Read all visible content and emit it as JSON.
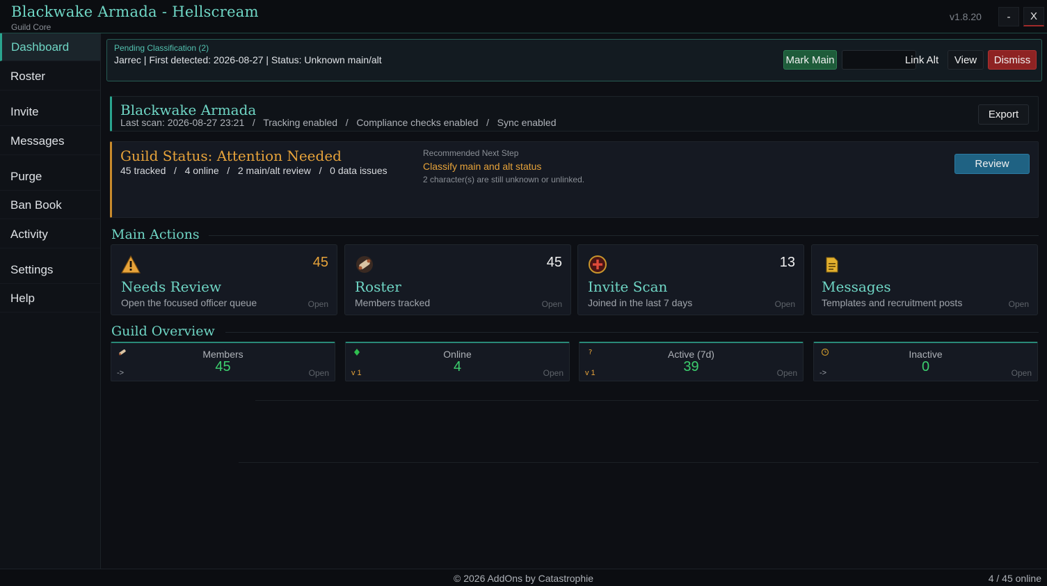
{
  "window": {
    "title": "Blackwake Armada - Hellscream",
    "subtitle": "Guild Core",
    "version": "v1.8.20",
    "minimize_label": "-",
    "close_label": "X"
  },
  "sidebar": {
    "items": [
      {
        "label": "Dashboard",
        "active": true
      },
      {
        "label": "Roster"
      },
      {
        "label": "Invite"
      },
      {
        "label": "Messages"
      },
      {
        "label": "Purge"
      },
      {
        "label": "Ban Book"
      },
      {
        "label": "Activity"
      },
      {
        "label": "Settings"
      },
      {
        "label": "Help"
      }
    ]
  },
  "pending": {
    "title": "Pending Classification (2)",
    "detail": "Jarrec | First detected: 2026-08-27 | Status: Unknown main/alt",
    "mark_main": "Mark Main",
    "link_alt": "Link Alt",
    "view": "View",
    "dismiss": "Dismiss"
  },
  "guild": {
    "name": "Blackwake Armada",
    "meta": "Last scan: 2026-08-27 23:21   /   Tracking enabled   /   Compliance checks enabled   /   Sync enabled",
    "export_label": "Export"
  },
  "status": {
    "title": "Guild Status: Attention Needed",
    "stats": "45 tracked   /   4 online   /   2 main/alt review   /   0 data issues",
    "next_label": "Recommended Next Step",
    "next_step": "Classify main and alt status",
    "next_note": "2 character(s) are still unknown or unlinked.",
    "review_label": "Review",
    "accent_color": "#e7a33a"
  },
  "main_actions": {
    "title": "Main Actions",
    "cards": [
      {
        "icon": "warning-icon",
        "count": "45",
        "title": "Needs Review",
        "desc": "Open the focused officer queue",
        "open": "Open"
      },
      {
        "icon": "scroll-icon",
        "count": "45",
        "title": "Roster",
        "desc": "Members tracked",
        "open": "Open"
      },
      {
        "icon": "plus-badge-icon",
        "count": "13",
        "title": "Invite Scan",
        "desc": "Joined in the last 7 days",
        "open": "Open"
      },
      {
        "icon": "document-icon",
        "count": "",
        "title": "Messages",
        "desc": "Templates and recruitment posts",
        "open": "Open"
      }
    ]
  },
  "overview": {
    "title": "Guild Overview",
    "cards": [
      {
        "icon": "scroll-icon",
        "label": "Members",
        "value": "45",
        "trend": "->",
        "open": "Open"
      },
      {
        "icon": "green-dot-icon",
        "label": "Online",
        "value": "4",
        "trend": "v 1",
        "open": "Open"
      },
      {
        "icon": "question-icon",
        "label": "Active (7d)",
        "value": "39",
        "trend": "v 1",
        "open": "Open"
      },
      {
        "icon": "clock-icon",
        "label": "Inactive",
        "value": "0",
        "trend": "->",
        "open": "Open"
      }
    ]
  },
  "footer": {
    "copyright": "© 2026 AddOns by Catastrophie",
    "online": "4 / 45 online"
  },
  "colors": {
    "teal": "#6fd6c5",
    "orange": "#e7a33a",
    "green": "#3ccf6e",
    "danger": "#8e2323",
    "primary": "#1f6283"
  }
}
